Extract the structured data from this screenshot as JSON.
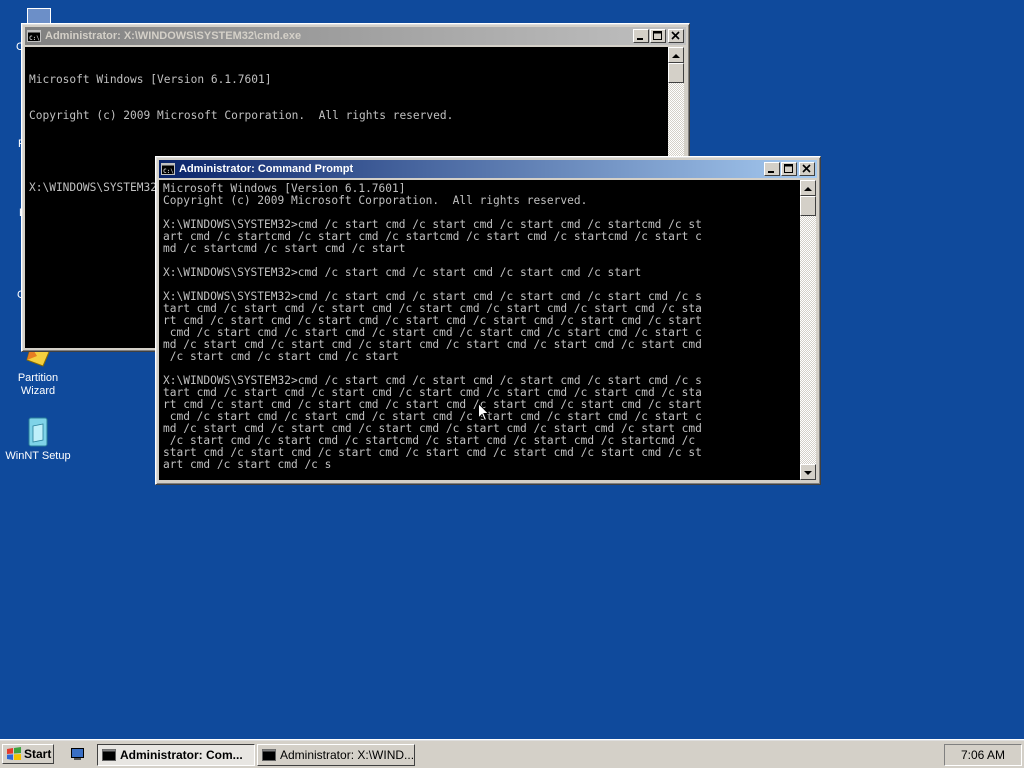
{
  "desktop": {
    "icons": [
      {
        "label": "Partition\nWizard",
        "icon": "partition-wizard-icon"
      },
      {
        "label": "WinNT Setup",
        "icon": "winnt-setup-icon"
      }
    ],
    "partial_labels": [
      "C",
      "P",
      "E",
      "G"
    ]
  },
  "window_back": {
    "title": "Administrator: X:\\WINDOWS\\SYSTEM32\\cmd.exe",
    "lines": [
      "Microsoft Windows [Version 6.1.7601]",
      "Copyright (c) 2009 Microsoft Corporation.  All rights reserved.",
      "",
      "X:\\WINDOWS\\SYSTEM32>"
    ]
  },
  "window_front": {
    "title": "Administrator: Command Prompt",
    "lines": [
      "Microsoft Windows [Version 6.1.7601]",
      "Copyright (c) 2009 Microsoft Corporation.  All rights reserved.",
      "",
      "X:\\WINDOWS\\SYSTEM32>cmd /c start cmd /c start cmd /c start cmd /c startcmd /c st",
      "art cmd /c startcmd /c start cmd /c startcmd /c start cmd /c startcmd /c start c",
      "md /c startcmd /c start cmd /c start",
      "",
      "X:\\WINDOWS\\SYSTEM32>cmd /c start cmd /c start cmd /c start cmd /c start",
      "",
      "X:\\WINDOWS\\SYSTEM32>cmd /c start cmd /c start cmd /c start cmd /c start cmd /c s",
      "tart cmd /c start cmd /c start cmd /c start cmd /c start cmd /c start cmd /c sta",
      "rt cmd /c start cmd /c start cmd /c start cmd /c start cmd /c start cmd /c start",
      " cmd /c start cmd /c start cmd /c start cmd /c start cmd /c start cmd /c start c",
      "md /c start cmd /c start cmd /c start cmd /c start cmd /c start cmd /c start cmd",
      " /c start cmd /c start cmd /c start",
      "",
      "X:\\WINDOWS\\SYSTEM32>cmd /c start cmd /c start cmd /c start cmd /c start cmd /c s",
      "tart cmd /c start cmd /c start cmd /c start cmd /c start cmd /c start cmd /c sta",
      "rt cmd /c start cmd /c start cmd /c start cmd /c start cmd /c start cmd /c start",
      " cmd /c start cmd /c start cmd /c start cmd /c start cmd /c start cmd /c start c",
      "md /c start cmd /c start cmd /c start cmd /c start cmd /c start cmd /c start cmd",
      " /c start cmd /c start cmd /c startcmd /c start cmd /c start cmd /c startcmd /c ",
      "start cmd /c start cmd /c start cmd /c start cmd /c start cmd /c start cmd /c st",
      "art cmd /c start cmd /c s"
    ]
  },
  "taskbar": {
    "start_label": "Start",
    "buttons": [
      {
        "label": "Administrator: Com..."
      },
      {
        "label": "Administrator: X:\\WIND..."
      }
    ],
    "clock": "7:06 AM"
  },
  "colors": {
    "desktop": "#0f4a9c",
    "title_active": "#0a246a",
    "title_inactive": "#808080",
    "console_bg": "#000000",
    "console_fg": "#c0c0c0"
  }
}
